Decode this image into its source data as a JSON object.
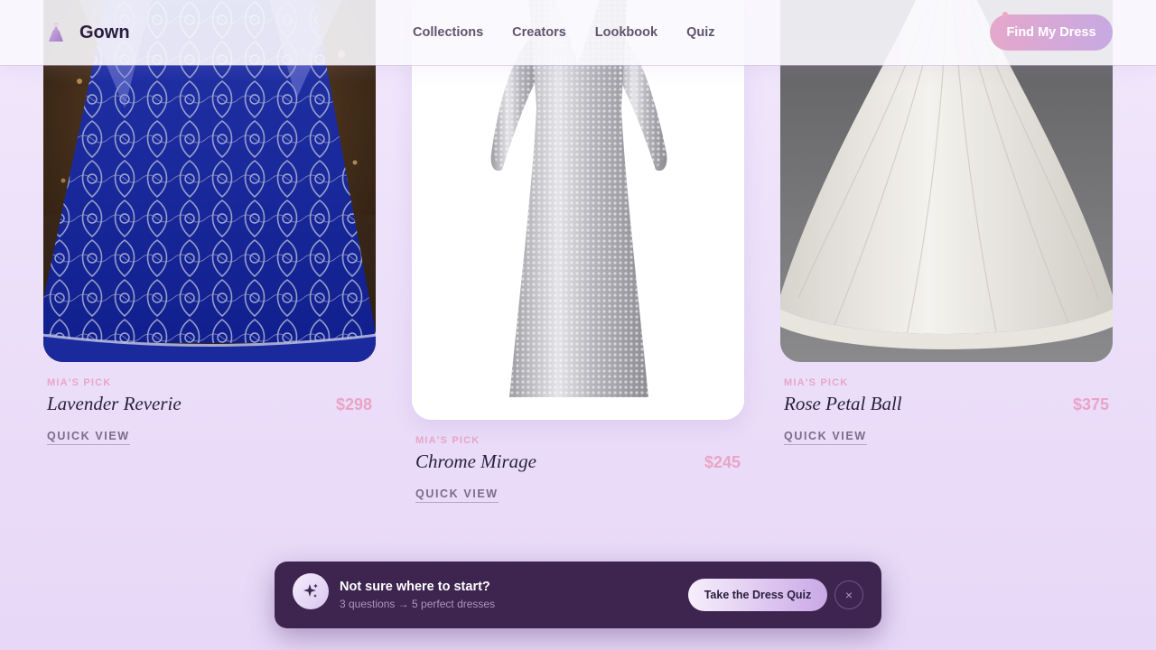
{
  "header": {
    "logo_text": "Gown",
    "logo_icon": "dress-icon",
    "nav": [
      "Collections",
      "Creators",
      "Lookbook",
      "Quiz"
    ],
    "cta_label": "Find My Dress"
  },
  "products": [
    {
      "badge": "MIA'S PICK",
      "name": "Lavender Reverie",
      "price": "$298",
      "action": "QUICK VIEW"
    },
    {
      "badge": "MIA'S PICK",
      "name": "Chrome Mirage",
      "price": "$245",
      "action": "QUICK VIEW"
    },
    {
      "badge": "MIA'S PICK",
      "name": "Rose Petal Ball",
      "price": "$375",
      "action": "QUICK VIEW"
    }
  ],
  "toast": {
    "icon": "sparkle-icon",
    "title": "Not sure where to start?",
    "subtitle": "3 questions → 5 perfect dresses",
    "button_label": "Take the Dress Quiz",
    "close_glyph": "×"
  },
  "colors": {
    "accent_pink": "#eaa4c6",
    "accent_lavender": "#c7a9e2",
    "toast_bg": "#3e2550"
  }
}
